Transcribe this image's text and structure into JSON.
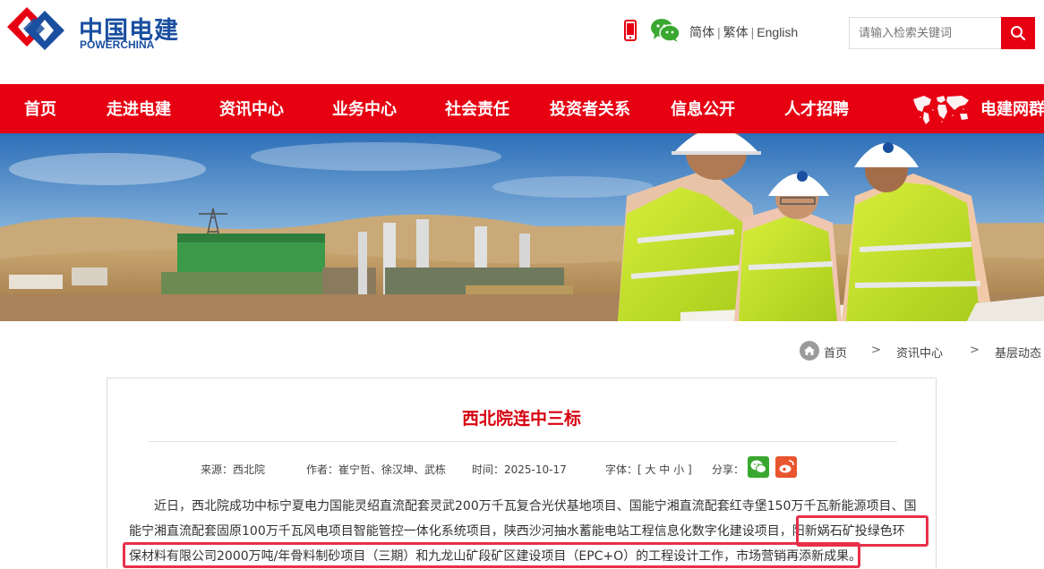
{
  "header": {
    "logo_cn": "中国电建",
    "logo_en": "POWERCHINA",
    "lang_simplified": "简体",
    "lang_traditional": "繁体",
    "lang_english": "English",
    "lang_separator": "|",
    "search_placeholder": "请输入检索关键词"
  },
  "nav": {
    "items": [
      "首页",
      "走进电建",
      "资讯中心",
      "业务中心",
      "社会责任",
      "投资者关系",
      "信息公开",
      "人才招聘",
      "电建网群"
    ]
  },
  "breadcrumb": {
    "home": "首页",
    "middle": "资讯中心",
    "current": "基层动态",
    "separator": ">"
  },
  "article": {
    "title": "西北院连中三标",
    "source": "来源：西北院",
    "authors": "作者：崔宁哲、徐汉坤、武栋",
    "date": "时间：2025-10-17",
    "font_size": "字体：[ 大 中 小 ]",
    "share": "分享：",
    "paragraph": "近日，西北院成功中标宁夏电力国能灵绍直流配套灵武200万千瓦复合光伏基地项目、国能宁湘直流配套红寺堡150万千瓦新能源项目、国能宁湘直流配套固原100万千瓦风电项目智能管控一体化系统项目，陕西沙河抽水蓄能电站工程信息化数字化建设项目，阳新娲石矿投绿色环保材料有限公司2000万吨/年骨料制砂项目（三期）和九龙山矿段矿区建设项目（EPC+O）的工程设计工作，市场营销再添新成果。"
  },
  "colors": {
    "brand_red": "#e60012",
    "title_red": "#d7000f",
    "brand_blue": "#1a4fa0",
    "highlight_border": "#e8304a"
  },
  "icons": [
    "phone-icon",
    "wechat-icon",
    "search-icon",
    "world-map-icon",
    "home-icon",
    "share-wechat-icon",
    "share-weibo-icon"
  ]
}
